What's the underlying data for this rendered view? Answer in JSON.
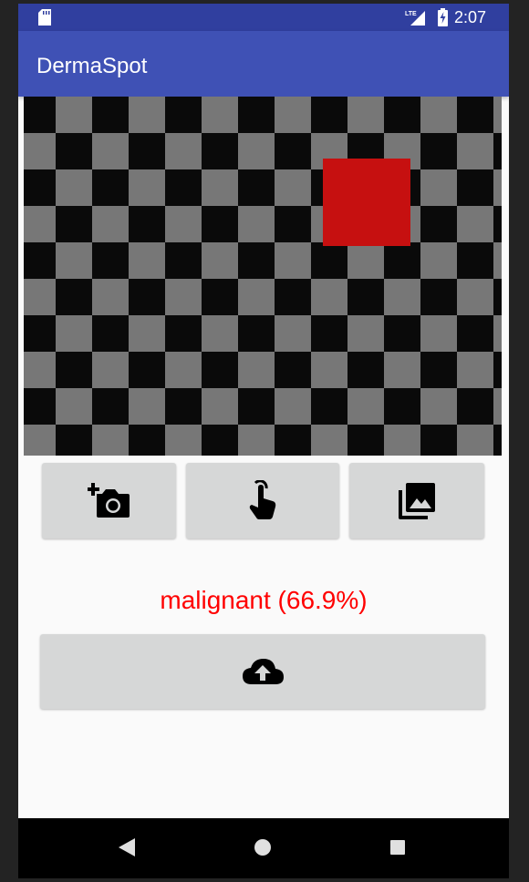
{
  "status_bar": {
    "network": "LTE",
    "time": "2:07",
    "icons": [
      "sd-card-icon",
      "lte-signal-icon",
      "battery-charging-icon"
    ]
  },
  "app_bar": {
    "title": "DermaSpot"
  },
  "image_preview": {
    "pattern": "checkerboard",
    "pattern_colors": [
      "#777777",
      "#0a0a0a"
    ],
    "marker_color": "#c61010"
  },
  "action_buttons": [
    {
      "name": "take-photo-button",
      "icon": "add-a-photo-icon"
    },
    {
      "name": "touch-select-button",
      "icon": "touch-app-icon"
    },
    {
      "name": "gallery-button",
      "icon": "photo-library-icon"
    }
  ],
  "result": {
    "text": "malignant (66.9%)",
    "color": "#ff0000"
  },
  "upload_button": {
    "icon": "cloud-upload-icon"
  },
  "nav_bar": {
    "icons": [
      "back-icon",
      "home-icon",
      "recents-icon"
    ]
  },
  "colors": {
    "primary": "#3f51b5",
    "primary_dark": "#303f9f",
    "button_bg": "#d6d7d7"
  }
}
